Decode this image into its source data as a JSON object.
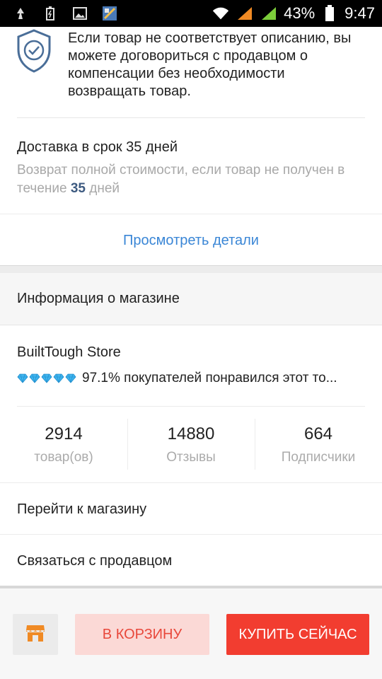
{
  "status_bar": {
    "battery_percent": "43%",
    "time": "9:47",
    "icons": [
      "recycle-icon",
      "battery-saver-icon",
      "image-icon",
      "app-icon",
      "wifi-icon",
      "signal-orange-icon",
      "signal-green-icon",
      "battery-icon"
    ],
    "colors": {
      "signal_orange": "#f08a24",
      "signal_green": "#7ccd3a"
    }
  },
  "guarantee": {
    "icon": "shield-check-icon",
    "text": "Если товар не соответствует описанию, вы можете договориться с продавцом о компенсации без необходимости возвращать товар."
  },
  "delivery": {
    "title": "Доставка в срок 35 дней",
    "note_before": "Возврат полной стоимости, если товар не получен в течение ",
    "note_days": "35",
    "note_after": " дней"
  },
  "details_link": "Просмотреть детали",
  "store": {
    "section_title": "Информация о магазине",
    "name": "BuiltTough Store",
    "diamond_count": 5,
    "rating_text": "97.1% покупателей понравился этот то...",
    "stats": [
      {
        "value": "2914",
        "label": "товар(ов)"
      },
      {
        "value": "14880",
        "label": "Отзывы"
      },
      {
        "value": "664",
        "label": "Подписчики"
      }
    ],
    "visit_label": "Перейти к магазину",
    "contact_label": "Связаться с продавцом"
  },
  "bottom_bar": {
    "store_icon": "store-icon",
    "cart_label": "В КОРЗИНУ",
    "buy_label": "КУПИТЬ СЕЙЧАС",
    "colors": {
      "accent": "#f23d30",
      "cart_bg": "#fbd9d6",
      "store_icon": "#f08a24",
      "link": "#3a86d6"
    }
  }
}
